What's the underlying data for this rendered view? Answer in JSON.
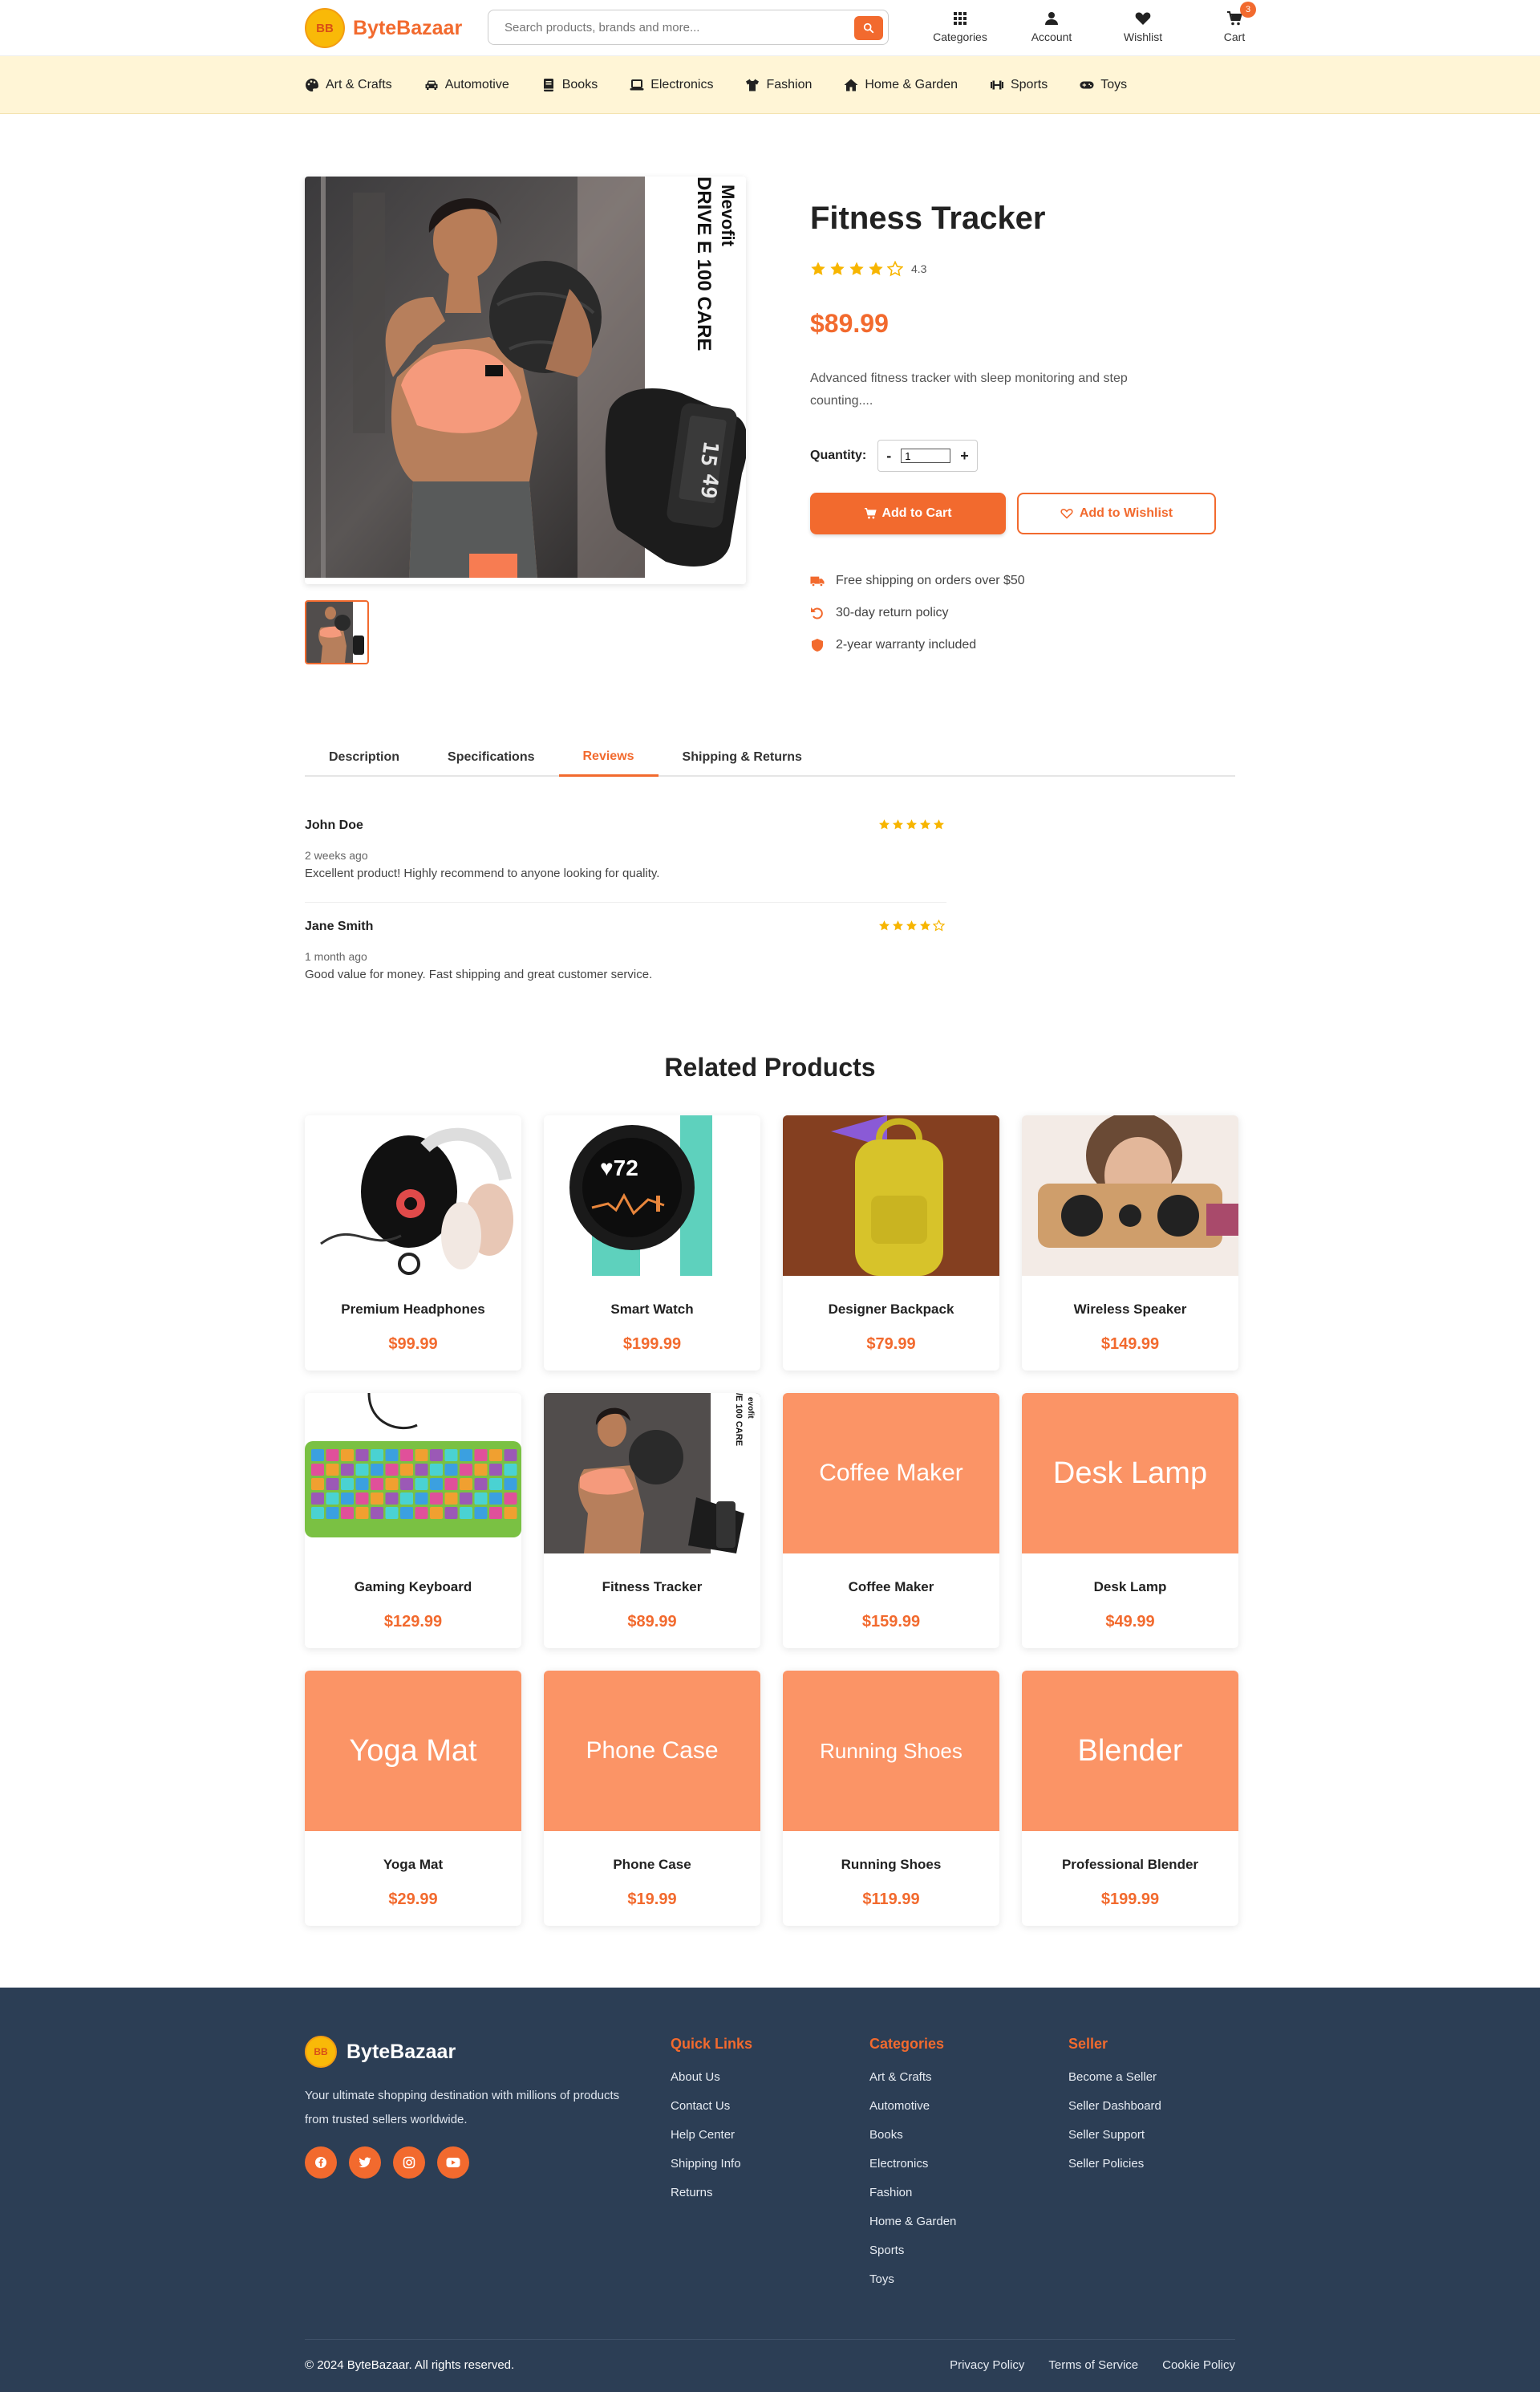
{
  "header": {
    "logo_mark": "BB",
    "brand": "ByteBazaar",
    "search_placeholder": "Search products, brands and more...",
    "actions": [
      {
        "label": "Categories",
        "icon": "grid-icon"
      },
      {
        "label": "Account",
        "icon": "user-icon"
      },
      {
        "label": "Wishlist",
        "icon": "heart-icon"
      },
      {
        "label": "Cart",
        "icon": "cart-icon"
      }
    ],
    "cart_count": "3"
  },
  "categories": [
    {
      "label": "Art & Crafts",
      "icon": "palette-icon"
    },
    {
      "label": "Automotive",
      "icon": "car-icon"
    },
    {
      "label": "Books",
      "icon": "book-icon"
    },
    {
      "label": "Electronics",
      "icon": "laptop-icon"
    },
    {
      "label": "Fashion",
      "icon": "shirt-icon"
    },
    {
      "label": "Home & Garden",
      "icon": "home-icon"
    },
    {
      "label": "Sports",
      "icon": "dumbbell-icon"
    },
    {
      "label": "Toys",
      "icon": "gamepad-icon"
    }
  ],
  "product": {
    "image_text_brand": "Mevofit",
    "image_text_model": "DRIVE E 100 CARE",
    "watch_display_top": "15",
    "watch_display_bottom": "49",
    "title": "Fitness Tracker",
    "rating": 4.3,
    "rating_label": "4.3",
    "price": "$89.99",
    "description": "Advanced fitness tracker with sleep monitoring and step counting....",
    "quantity_label": "Quantity:",
    "quantity_value": "1",
    "qty_minus": "-",
    "qty_plus": "+",
    "add_to_cart": "Add to Cart",
    "add_to_wishlist": "Add to Wishlist",
    "features": [
      {
        "text": "Free shipping on orders over $50",
        "icon": "truck-icon"
      },
      {
        "text": "30-day return policy",
        "icon": "undo-icon"
      },
      {
        "text": "2-year warranty included",
        "icon": "shield-icon"
      }
    ]
  },
  "tabs": [
    {
      "label": "Description",
      "active": false
    },
    {
      "label": "Specifications",
      "active": false
    },
    {
      "label": "Reviews",
      "active": true
    },
    {
      "label": "Shipping & Returns",
      "active": false
    }
  ],
  "reviews": [
    {
      "name": "John Doe",
      "rating": 5,
      "date": "2 weeks ago",
      "text": "Excellent product! Highly recommend to anyone looking for quality."
    },
    {
      "name": "Jane Smith",
      "rating": 4,
      "date": "1 month ago",
      "text": "Good value for money. Fast shipping and great customer service."
    }
  ],
  "related": {
    "title": "Related Products",
    "items": [
      {
        "name": "Premium Headphones",
        "price": "$99.99",
        "image": "headphones"
      },
      {
        "name": "Smart Watch",
        "price": "$199.99",
        "image": "smartwatch"
      },
      {
        "name": "Designer Backpack",
        "price": "$79.99",
        "image": "backpack"
      },
      {
        "name": "Wireless Speaker",
        "price": "$149.99",
        "image": "speaker"
      },
      {
        "name": "Gaming Keyboard",
        "price": "$129.99",
        "image": "keyboard"
      },
      {
        "name": "Fitness Tracker",
        "price": "$89.99",
        "image": "fitness"
      },
      {
        "name": "Coffee Maker",
        "price": "$159.99",
        "placeholder": "Coffee Maker"
      },
      {
        "name": "Desk Lamp",
        "price": "$49.99",
        "placeholder": "Desk Lamp"
      },
      {
        "name": "Yoga Mat",
        "price": "$29.99",
        "placeholder": "Yoga Mat"
      },
      {
        "name": "Phone Case",
        "price": "$19.99",
        "placeholder": "Phone Case"
      },
      {
        "name": "Running Shoes",
        "price": "$119.99",
        "placeholder": "Running Shoes"
      },
      {
        "name": "Professional Blender",
        "price": "$199.99",
        "placeholder": "Blender"
      }
    ]
  },
  "footer": {
    "brand": "ByteBazaar",
    "tagline": "Your ultimate shopping destination with millions of products from trusted sellers worldwide.",
    "social": [
      "facebook-icon",
      "twitter-icon",
      "instagram-icon",
      "youtube-icon"
    ],
    "columns": [
      {
        "title": "Quick Links",
        "links": [
          "About Us",
          "Contact Us",
          "Help Center",
          "Shipping Info",
          "Returns"
        ]
      },
      {
        "title": "Categories",
        "links": [
          "Art & Crafts",
          "Automotive",
          "Books",
          "Electronics",
          "Fashion",
          "Home & Garden",
          "Sports",
          "Toys"
        ]
      },
      {
        "title": "Seller",
        "links": [
          "Become a Seller",
          "Seller Dashboard",
          "Seller Support",
          "Seller Policies"
        ]
      }
    ],
    "copyright": "© 2024 ByteBazaar. All rights reserved.",
    "legal": [
      "Privacy Policy",
      "Terms of Service",
      "Cookie Policy"
    ]
  },
  "colors": {
    "accent": "#f26a2e",
    "catbar": "#fff5d6",
    "footer": "#2c3e55",
    "star": "#f7b500",
    "placeholder": "#fb9466"
  }
}
